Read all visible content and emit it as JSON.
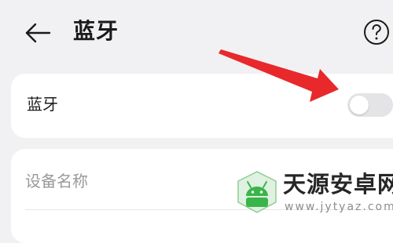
{
  "header": {
    "back_icon": "arrow-left-icon",
    "title": "蓝牙",
    "help_icon": "question-circle-icon"
  },
  "bluetooth_row": {
    "label": "蓝牙",
    "toggle_on": false
  },
  "device_name_row": {
    "label": "设备名称"
  },
  "annotation": {
    "type": "red-arrow",
    "points_to": "bluetooth-toggle",
    "color": "#e8282b"
  },
  "watermark": {
    "title": "天源安卓网",
    "url": "www.jytyaz.com",
    "logo_color": "#39b54a"
  },
  "colors": {
    "background": "#f1f1f3",
    "card": "#ffffff",
    "toggle_off_track": "#e4e4e6",
    "label_muted": "#9a9a9a"
  }
}
